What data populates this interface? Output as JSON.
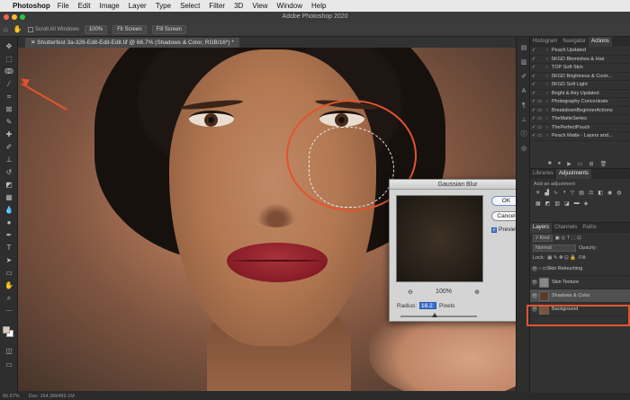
{
  "menubar": {
    "app": "Photoshop",
    "items": [
      "File",
      "Edit",
      "Image",
      "Layer",
      "Type",
      "Select",
      "Filter",
      "3D",
      "View",
      "Window",
      "Help"
    ]
  },
  "window": {
    "title": "Adobe Photoshop 2020"
  },
  "options": {
    "scroll_all": "Scroll All Windows",
    "zoom": "100%",
    "fit_screen": "Fit Screen",
    "fill_screen": "Fill Screen"
  },
  "document": {
    "tab": "Shutterfest 3a-326-Edit-Edit-Edit.tif @ 66.7% (Shadows & Color, RGB/16*) *"
  },
  "dialog": {
    "title": "Gaussian Blur",
    "ok": "OK",
    "cancel": "Cancel",
    "preview": "Preview",
    "zoom": "100%",
    "radius_label": "Radius:",
    "radius_value": "16.2",
    "radius_unit": "Pixels"
  },
  "panels": {
    "top_tabs": [
      "Histogram",
      "Navigator",
      "Actions"
    ],
    "actions": [
      {
        "label": "Peach Updated",
        "type": "action"
      },
      {
        "label": "5KGD Blemishes & Hair",
        "type": "action"
      },
      {
        "label": "TOP Soft Skin",
        "type": "action"
      },
      {
        "label": "5KGD Brightness & Contr...",
        "type": "action"
      },
      {
        "label": "5KGD Soft Light",
        "type": "action"
      },
      {
        "label": "Bright & Airy Updated",
        "type": "action"
      },
      {
        "label": "Photography Concentrate",
        "type": "set"
      },
      {
        "label": "BreakdownBeginnerActions",
        "type": "set"
      },
      {
        "label": "TheMatteSeries",
        "type": "set"
      },
      {
        "label": "ThePerfectPouch",
        "type": "set"
      },
      {
        "label": "Peach Matte - Layers and...",
        "type": "set"
      }
    ],
    "mid_tabs": [
      "Libraries",
      "Adjustments"
    ],
    "adjust_title": "Add an adjustment",
    "layer_tabs": [
      "Layers",
      "Channels",
      "Paths"
    ],
    "kind": "Kind",
    "blend": "Normal",
    "opacity_label": "Opacity:",
    "lock_label": "Lock:",
    "fill_label": "Fill:",
    "layers": [
      {
        "label": "Skin Relouching",
        "kind": "group"
      },
      {
        "label": "Skin Texture",
        "kind": "layer"
      },
      {
        "label": "Shadows & Color",
        "kind": "layer",
        "selected": true
      },
      {
        "label": "Background",
        "kind": "layer"
      }
    ]
  },
  "status": {
    "zoom": "66.67%",
    "doc": "Doc: 164.3M/499.1M"
  },
  "colors": {
    "accent": "#e2542e"
  }
}
